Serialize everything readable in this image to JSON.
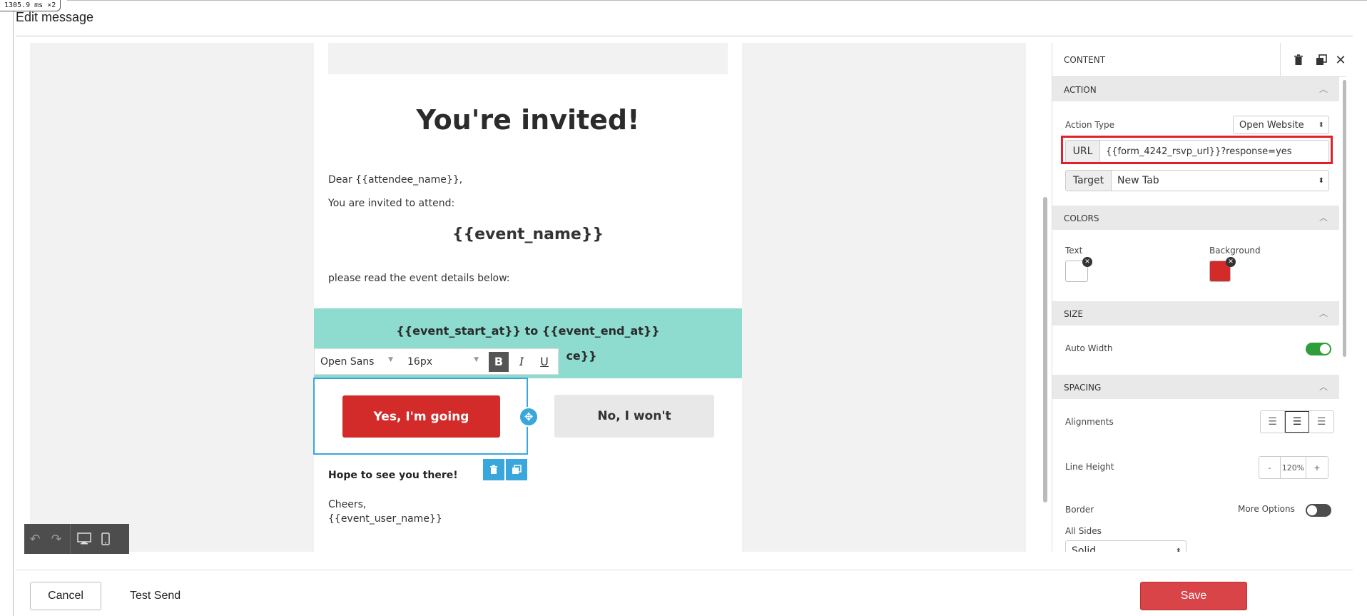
{
  "timing_badge": "1305.9 ms ×2",
  "header": {
    "title": "Edit message"
  },
  "email": {
    "heading": "You're invited!",
    "greeting": "Dear {{attendee_name}},",
    "invite_line": "You are invited to attend:",
    "event_name": "{{event_name}}",
    "details_line": "please read the event details below:",
    "time_line": "{{event_start_at}} to {{event_end_at}}",
    "location_line_partial": "ce}}",
    "yes_button": "Yes, I'm going",
    "no_button": "No, I won't",
    "hope": "Hope to see you there!",
    "signoff": "Cheers,",
    "signature": "{{event_user_name}}"
  },
  "text_toolbar": {
    "font": "Open Sans",
    "size": "16px",
    "bold": "B",
    "italic": "I",
    "underline": "U"
  },
  "panel": {
    "title": "CONTENT",
    "action": {
      "section": "ACTION",
      "action_type_label": "Action Type",
      "action_type_value": "Open Website",
      "url_addon": "URL",
      "url_value": "{{form_4242_rsvp_url}}?response=yes",
      "target_addon": "Target",
      "target_value": "New Tab"
    },
    "colors": {
      "section": "COLORS",
      "text_label": "Text",
      "background_label": "Background",
      "text_color": "#ffffff",
      "background_color": "#d32a2a"
    },
    "size": {
      "section": "SIZE",
      "auto_width_label": "Auto Width",
      "auto_width_on": true
    },
    "spacing": {
      "section": "SPACING",
      "alignments_label": "Alignments",
      "line_height_label": "Line Height",
      "line_height_minus": "-",
      "line_height_value": "120%",
      "line_height_plus": "+",
      "border_label": "Border",
      "more_options_label": "More Options",
      "all_sides_label": "All Sides",
      "border_style": "Solid"
    }
  },
  "footer": {
    "cancel": "Cancel",
    "test_send": "Test Send",
    "save": "Save"
  },
  "colors": {
    "accent_blue": "#3aa7dc",
    "save_red": "#d94448",
    "teal": "#8ddccf",
    "highlight_red": "#e2202a",
    "toggle_green": "#2e9e3a"
  }
}
